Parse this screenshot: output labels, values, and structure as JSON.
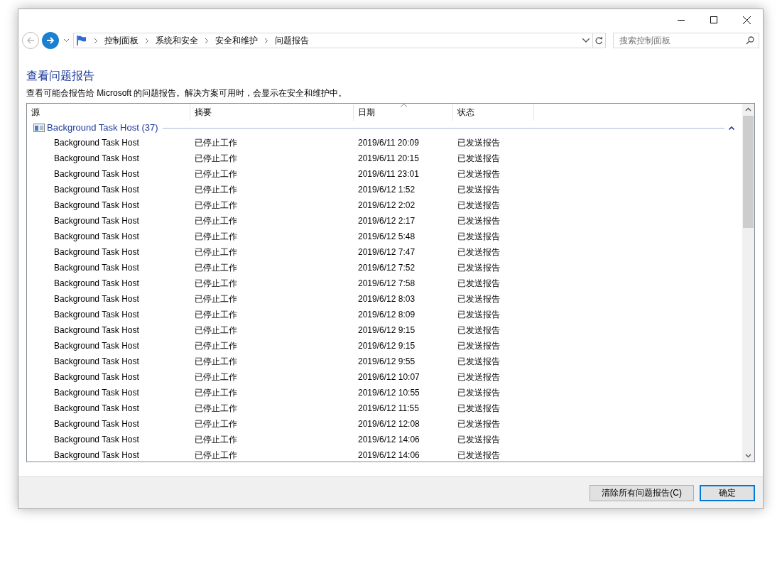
{
  "breadcrumb": [
    "控制面板",
    "系统和安全",
    "安全和维护",
    "问题报告"
  ],
  "search": {
    "placeholder": "搜索控制面板"
  },
  "heading": "查看问题报告",
  "description": "查看可能会报告给 Microsoft 的问题报告。解决方案可用时，会显示在安全和维护中。",
  "columns": [
    {
      "label": "源",
      "sorted": false
    },
    {
      "label": "摘要",
      "sorted": false
    },
    {
      "label": "日期",
      "sorted": true
    },
    {
      "label": "状态",
      "sorted": false
    }
  ],
  "group": {
    "label": "Background Task Host (37)",
    "expanded": true
  },
  "rows": [
    {
      "source": "Background Task Host",
      "summary": "已停止工作",
      "date": "2019/6/11 20:09",
      "status": "已发送报告"
    },
    {
      "source": "Background Task Host",
      "summary": "已停止工作",
      "date": "2019/6/11 20:15",
      "status": "已发送报告"
    },
    {
      "source": "Background Task Host",
      "summary": "已停止工作",
      "date": "2019/6/11 23:01",
      "status": "已发送报告"
    },
    {
      "source": "Background Task Host",
      "summary": "已停止工作",
      "date": "2019/6/12 1:52",
      "status": "已发送报告"
    },
    {
      "source": "Background Task Host",
      "summary": "已停止工作",
      "date": "2019/6/12 2:02",
      "status": "已发送报告"
    },
    {
      "source": "Background Task Host",
      "summary": "已停止工作",
      "date": "2019/6/12 2:17",
      "status": "已发送报告"
    },
    {
      "source": "Background Task Host",
      "summary": "已停止工作",
      "date": "2019/6/12 5:48",
      "status": "已发送报告"
    },
    {
      "source": "Background Task Host",
      "summary": "已停止工作",
      "date": "2019/6/12 7:47",
      "status": "已发送报告"
    },
    {
      "source": "Background Task Host",
      "summary": "已停止工作",
      "date": "2019/6/12 7:52",
      "status": "已发送报告"
    },
    {
      "source": "Background Task Host",
      "summary": "已停止工作",
      "date": "2019/6/12 7:58",
      "status": "已发送报告"
    },
    {
      "source": "Background Task Host",
      "summary": "已停止工作",
      "date": "2019/6/12 8:03",
      "status": "已发送报告"
    },
    {
      "source": "Background Task Host",
      "summary": "已停止工作",
      "date": "2019/6/12 8:09",
      "status": "已发送报告"
    },
    {
      "source": "Background Task Host",
      "summary": "已停止工作",
      "date": "2019/6/12 9:15",
      "status": "已发送报告"
    },
    {
      "source": "Background Task Host",
      "summary": "已停止工作",
      "date": "2019/6/12 9:15",
      "status": "已发送报告"
    },
    {
      "source": "Background Task Host",
      "summary": "已停止工作",
      "date": "2019/6/12 9:55",
      "status": "已发送报告"
    },
    {
      "source": "Background Task Host",
      "summary": "已停止工作",
      "date": "2019/6/12 10:07",
      "status": "已发送报告"
    },
    {
      "source": "Background Task Host",
      "summary": "已停止工作",
      "date": "2019/6/12 10:55",
      "status": "已发送报告"
    },
    {
      "source": "Background Task Host",
      "summary": "已停止工作",
      "date": "2019/6/12 11:55",
      "status": "已发送报告"
    },
    {
      "source": "Background Task Host",
      "summary": "已停止工作",
      "date": "2019/6/12 12:08",
      "status": "已发送报告"
    },
    {
      "source": "Background Task Host",
      "summary": "已停止工作",
      "date": "2019/6/12 14:06",
      "status": "已发送报告"
    },
    {
      "source": "Background Task Host",
      "summary": "已停止工作",
      "date": "2019/6/12 14:06",
      "status": "已发送报告"
    }
  ],
  "buttons": [
    {
      "label": "清除所有问题报告(C)",
      "default": false
    },
    {
      "label": "确定",
      "default": true
    }
  ]
}
